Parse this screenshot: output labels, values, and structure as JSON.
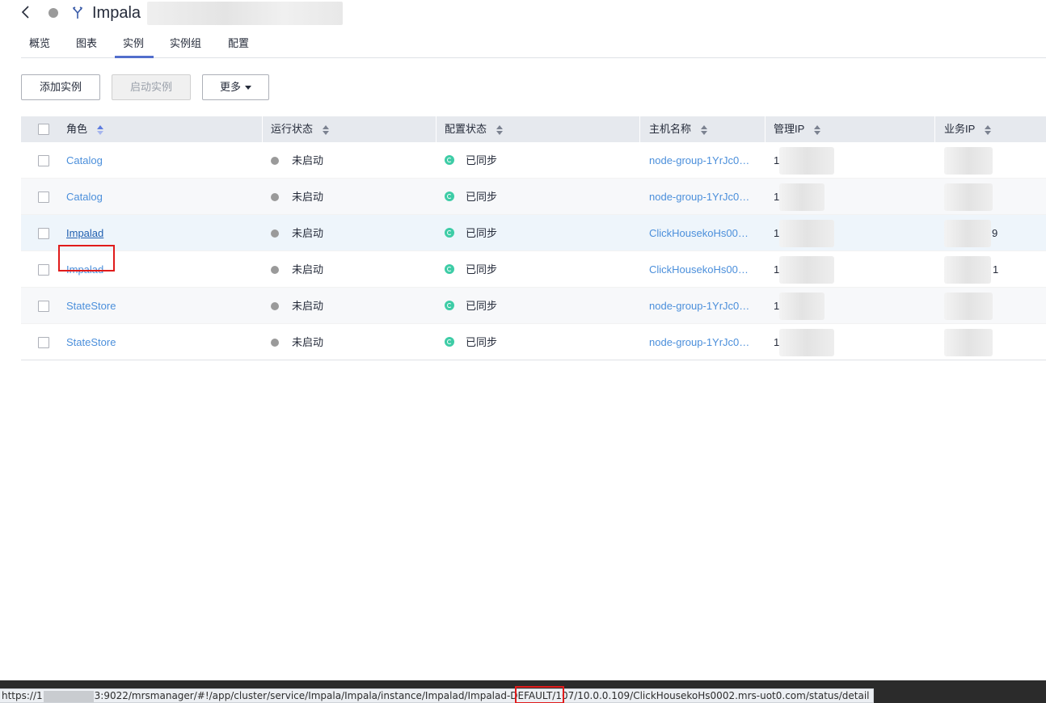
{
  "header": {
    "service_name": "Impala",
    "back_icon": "chevron-left-icon",
    "service_icon": "impala-icon",
    "status_color": "#9a9a9a"
  },
  "tabs": [
    {
      "label": "概览",
      "active": false
    },
    {
      "label": "图表",
      "active": false
    },
    {
      "label": "实例",
      "active": true
    },
    {
      "label": "实例组",
      "active": false
    },
    {
      "label": "配置",
      "active": false
    }
  ],
  "toolbar": {
    "add_label": "添加实例",
    "start_label": "启动实例",
    "more_label": "更多"
  },
  "table": {
    "columns": [
      "角色",
      "运行状态",
      "配置状态",
      "主机名称",
      "管理IP",
      "业务IP"
    ],
    "rows": [
      {
        "role": "Catalog",
        "run_status": "未启动",
        "config_status": "已同步",
        "host": "node-group-1YrJc0…",
        "mgmt_ip": "1",
        "biz_ip": ""
      },
      {
        "role": "Catalog",
        "run_status": "未启动",
        "config_status": "已同步",
        "host": "node-group-1YrJc0…",
        "mgmt_ip": "1",
        "biz_ip": ""
      },
      {
        "role": "Impalad",
        "run_status": "未启动",
        "config_status": "已同步",
        "host": "ClickHousekoHs00…",
        "mgmt_ip": "1",
        "biz_ip": "9"
      },
      {
        "role": "Impalad",
        "run_status": "未启动",
        "config_status": "已同步",
        "host": "ClickHousekoHs00…",
        "mgmt_ip": "1",
        "biz_ip": "1"
      },
      {
        "role": "StateStore",
        "run_status": "未启动",
        "config_status": "已同步",
        "host": "node-group-1YrJc0…",
        "mgmt_ip": "1",
        "biz_ip": ""
      },
      {
        "role": "StateStore",
        "run_status": "未启动",
        "config_status": "已同步",
        "host": "node-group-1YrJc0…",
        "mgmt_ip": "1",
        "biz_ip": ""
      }
    ]
  },
  "statusbar": {
    "url_prefix": "https://1",
    "url_rest": "3:9022/mrsmanager/#!/app/cluster/service/Impala/Impala/instance/Impalad/Impalad-DEFAULT/107/10.0.0.109/ClickHousekoHs0002.mrs-uot0.com/status/detail"
  },
  "colors": {
    "link": "#4b8fdb",
    "accent": "#526ecc",
    "sync": "#3dcca6",
    "highlight_box": "#e01b1b"
  }
}
